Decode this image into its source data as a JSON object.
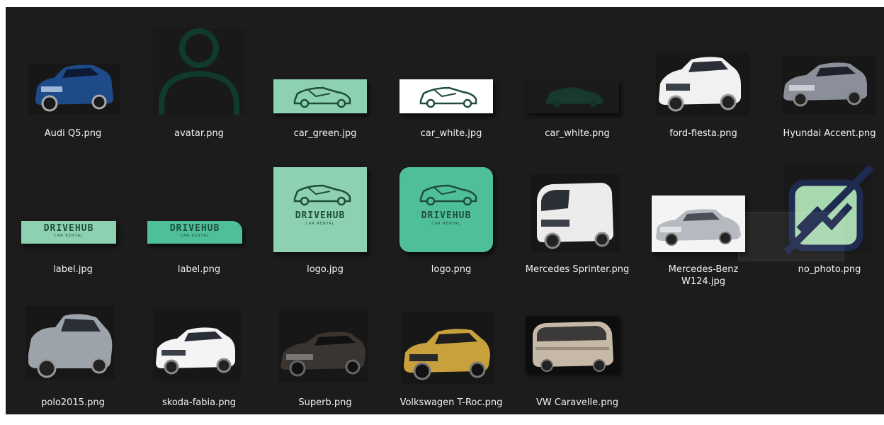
{
  "colors": {
    "pane_bg": "#1c1c1c",
    "filename_text": "#f2f2f2",
    "brand_green": "#8ed1b0",
    "brand_teal": "#4fbf98",
    "brand_dark": "#1f4d3b",
    "navy": "#1e2a4f"
  },
  "files": [
    {
      "name": "Audi Q5.png",
      "icon": "blue-suv-image"
    },
    {
      "name": "avatar.png",
      "icon": "person-avatar-icon"
    },
    {
      "name": "car_green.jpg",
      "icon": "car-outline-green-image"
    },
    {
      "name": "car_white.jpg",
      "icon": "car-outline-white-image"
    },
    {
      "name": "car_white.png",
      "icon": "car-outline-dark-image"
    },
    {
      "name": "ford-fiesta.png",
      "icon": "white-hatchback-image"
    },
    {
      "name": "Hyundai Accent.png",
      "icon": "grey-sedan-image"
    },
    {
      "name": "label.jpg",
      "icon": "drivehub-label-image",
      "brand": "DRIVEHUB",
      "tagline": "CAR RENTAL"
    },
    {
      "name": "label.png",
      "icon": "drivehub-label-image",
      "brand": "DRIVEHUB",
      "tagline": "CAR RENTAL"
    },
    {
      "name": "logo.jpg",
      "icon": "drivehub-logo-image",
      "brand": "DRIVEHUB",
      "tagline": "CAR RENTAL"
    },
    {
      "name": "logo.png",
      "icon": "drivehub-logo-image",
      "brand": "DRIVEHUB",
      "tagline": "CAR RENTAL"
    },
    {
      "name": "Mercedes Sprinter.png",
      "icon": "white-van-image"
    },
    {
      "name": "Mercedes-Benz W124.jpg",
      "icon": "silver-sedan-image"
    },
    {
      "name": "no_photo.png",
      "icon": "no-photo-icon"
    },
    {
      "name": "polo2015.png",
      "icon": "silver-hatchback-image"
    },
    {
      "name": "skoda-fabia.png",
      "icon": "white-hatchback-image"
    },
    {
      "name": "Superb.png",
      "icon": "dark-sedan-image"
    },
    {
      "name": "Volkswagen T-Roc.png",
      "icon": "yellow-suv-image"
    },
    {
      "name": "VW Caravelle.png",
      "icon": "minivan-image"
    }
  ]
}
